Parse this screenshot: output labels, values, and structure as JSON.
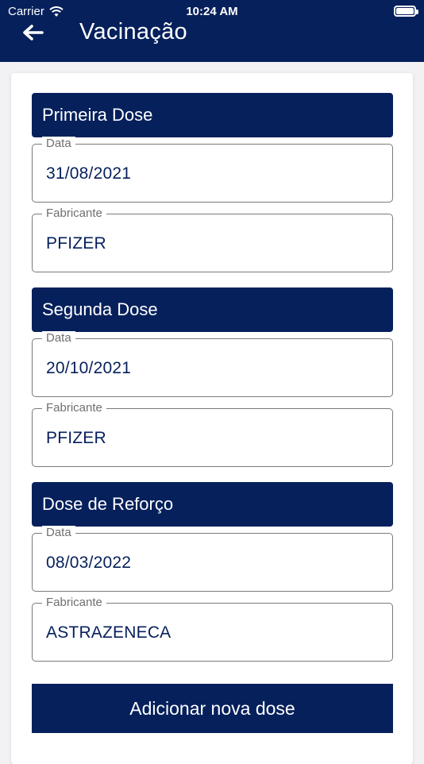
{
  "status_bar": {
    "carrier": "Carrier",
    "time": "10:24 AM"
  },
  "header": {
    "title": "Vacinação",
    "back_icon": "arrow-left-icon"
  },
  "doses": [
    {
      "title": "Primeira Dose",
      "date_label": "Data",
      "date": "31/08/2021",
      "manufacturer_label": "Fabricante",
      "manufacturer": "PFIZER"
    },
    {
      "title": "Segunda Dose",
      "date_label": "Data",
      "date": "20/10/2021",
      "manufacturer_label": "Fabricante",
      "manufacturer": "PFIZER"
    },
    {
      "title": "Dose de Reforço",
      "date_label": "Data",
      "date": "08/03/2022",
      "manufacturer_label": "Fabricante",
      "manufacturer": "ASTRAZENECA"
    }
  ],
  "add_button": {
    "label": "Adicionar nova dose"
  },
  "colors": {
    "primary": "#06205c",
    "background": "#f2f2f4",
    "field_border": "#7a7a7a",
    "label": "#6f6f6f"
  }
}
